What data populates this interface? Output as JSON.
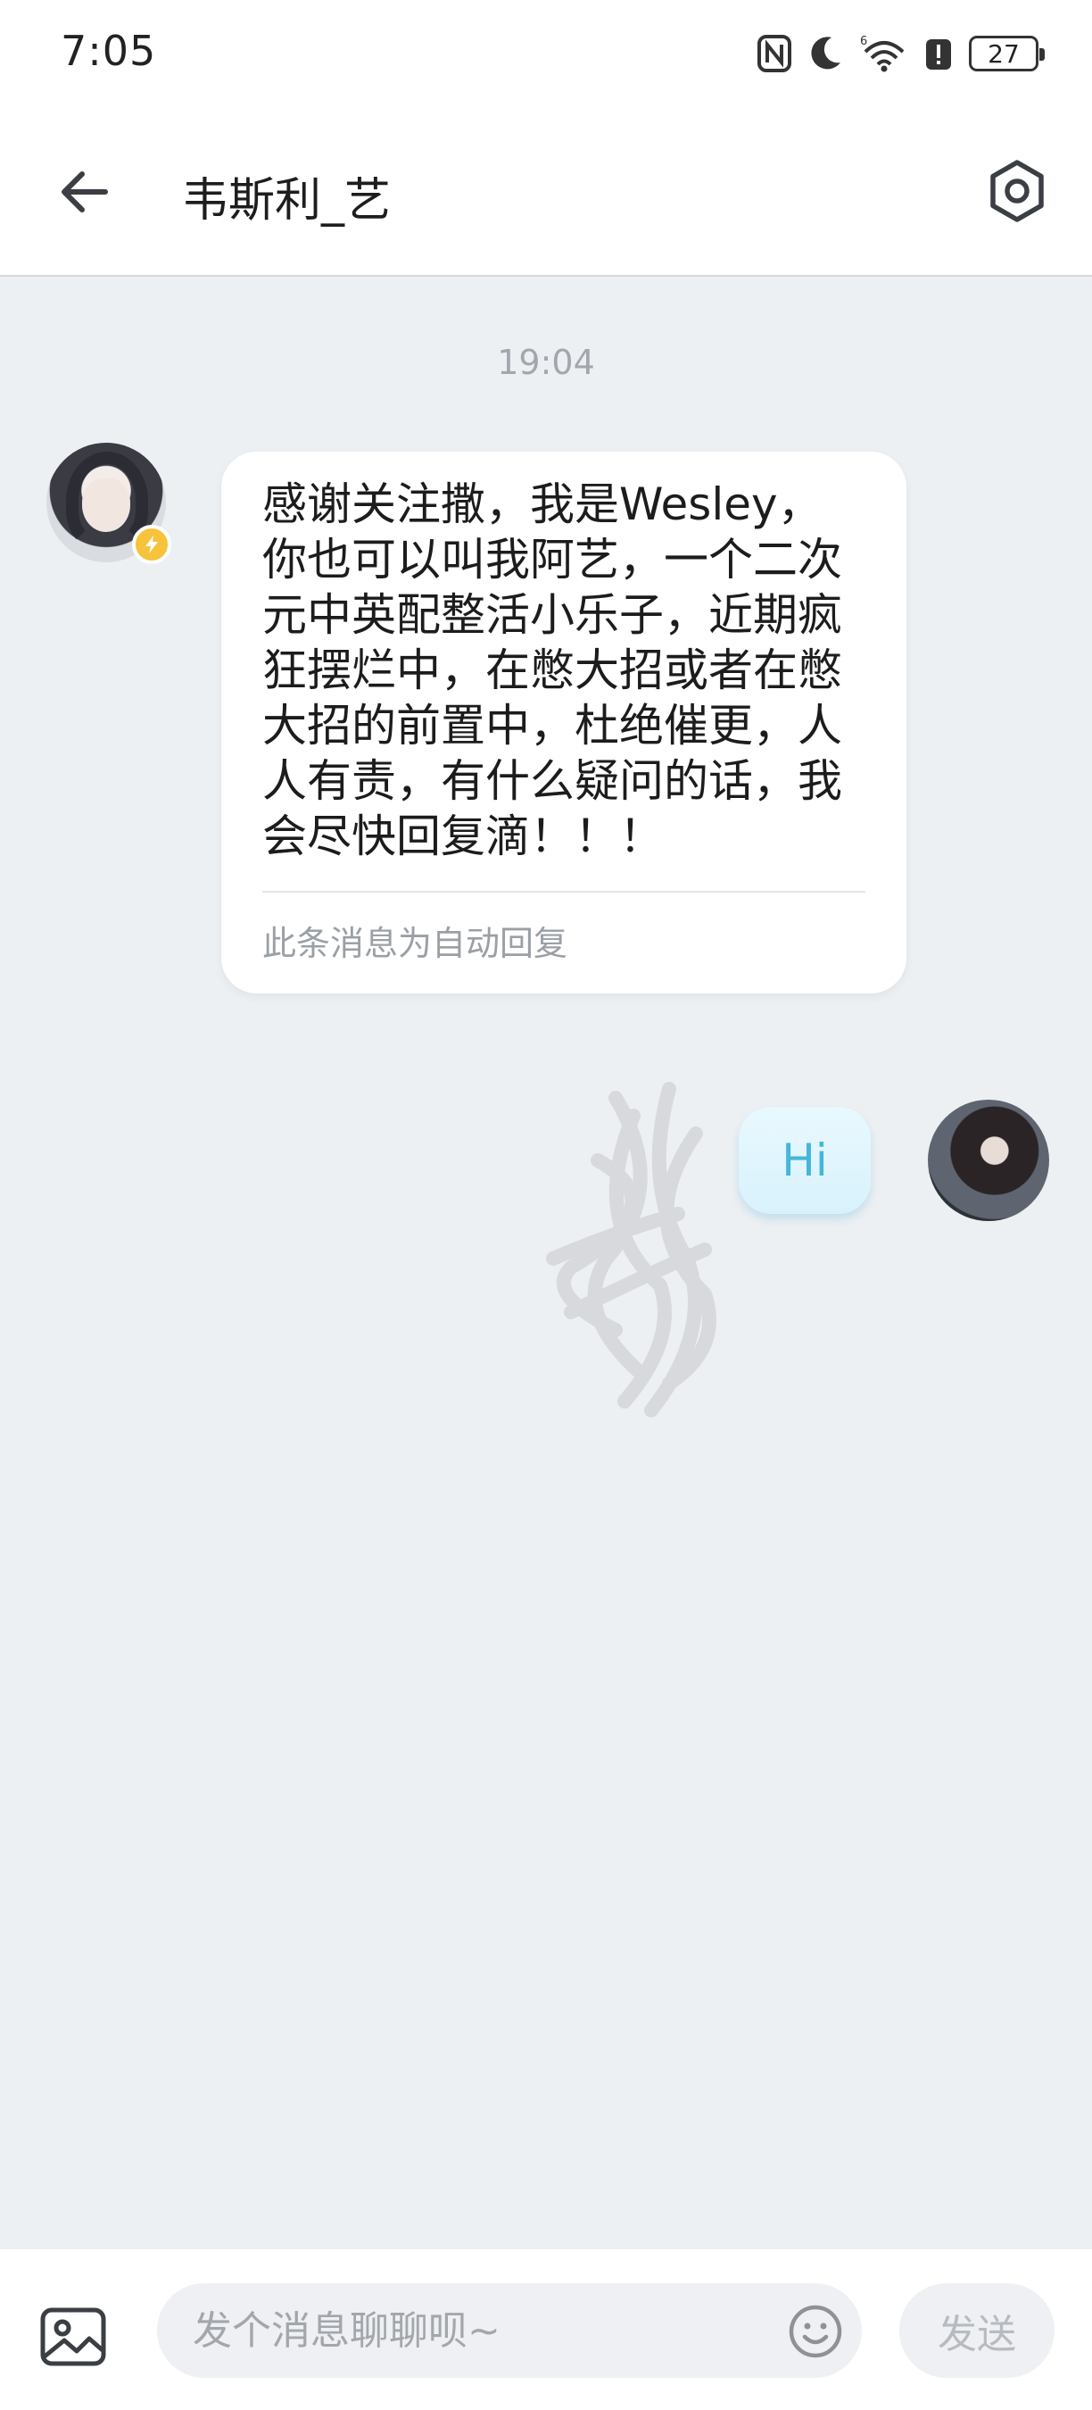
{
  "status_bar": {
    "time": "7:05",
    "battery_level": "27",
    "icons": [
      "nfc-icon",
      "moon-icon",
      "wifi-icon",
      "alert-icon",
      "battery-icon"
    ]
  },
  "header": {
    "title": "韦斯利_艺",
    "back_icon": "arrow-left-icon",
    "settings_icon": "hexagon-settings-icon"
  },
  "chat": {
    "timestamp": "19:04",
    "messages": [
      {
        "sender": "other",
        "text": "感谢关注撒，我是Wesley，你也可以叫我阿艺，一个二次元中英配整活小乐子，近期疯狂摆烂中，在憋大招或者在憋大招的前置中，杜绝催更，人人有责，有什么疑问的话，我会尽快回复滴！！！",
        "note": "此条消息为自动回复"
      },
      {
        "sender": "me",
        "text": "Hi"
      }
    ]
  },
  "input_bar": {
    "placeholder": "发个消息聊聊呗~",
    "value": "",
    "send_label": "发送"
  },
  "colors": {
    "chat_background": "#edf0f3",
    "my_bubble": "#dff4fd",
    "my_text": "#46b6d8",
    "badge": "#f6c33a"
  }
}
